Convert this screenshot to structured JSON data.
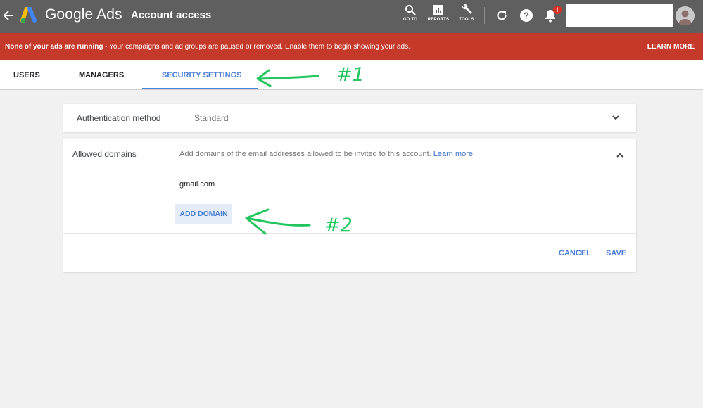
{
  "header": {
    "brand": "Google Ads",
    "title": "Account access",
    "tools": [
      {
        "label": "GO TO",
        "icon": "search-icon"
      },
      {
        "label": "REPORTS",
        "icon": "reports-icon"
      },
      {
        "label": "TOOLS",
        "icon": "wrench-icon"
      }
    ],
    "notification_badge": "!",
    "account_search_value": ""
  },
  "alert": {
    "bold_text": "None of your ads are running",
    "text": " - Your campaigns and ad groups are paused or removed. Enable them to begin showing your ads.",
    "action": "LEARN MORE"
  },
  "tabs": [
    {
      "label": "USERS",
      "active": false
    },
    {
      "label": "MANAGERS",
      "active": false
    },
    {
      "label": "SECURITY SETTINGS",
      "active": true
    }
  ],
  "auth_card": {
    "label": "Authentication method",
    "value": "Standard"
  },
  "domains_card": {
    "label": "Allowed domains",
    "description": "Add domains of the email addresses allowed to be invited to this account.",
    "learn_more": "Learn more",
    "domain_value": "gmail.com",
    "add_button": "ADD DOMAIN",
    "cancel": "CANCEL",
    "save": "SAVE"
  },
  "annotations": {
    "first": "#1",
    "second": "#2"
  },
  "colors": {
    "accent": "#4a7fd6",
    "alert": "#c5392a",
    "header": "#5f5f5f",
    "annotation": "#22c55e"
  }
}
